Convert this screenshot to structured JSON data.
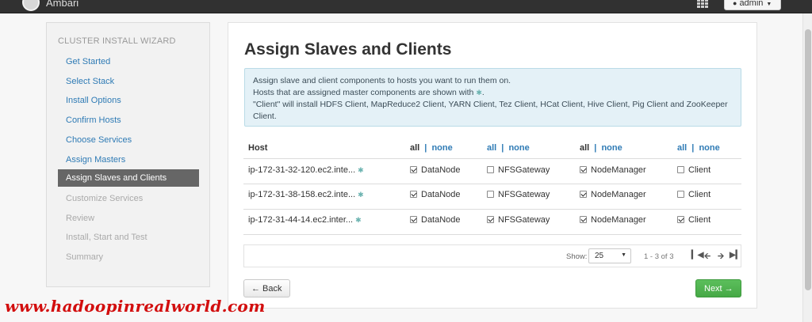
{
  "navbar": {
    "brand": "Ambari",
    "user_label": "admin",
    "icons": {
      "apps": "grid-icon",
      "user": "user-icon",
      "caret": "caret-down-icon"
    }
  },
  "sidebar": {
    "title": "CLUSTER INSTALL WIZARD",
    "steps": [
      {
        "label": "Get Started",
        "state": "done"
      },
      {
        "label": "Select Stack",
        "state": "done"
      },
      {
        "label": "Install Options",
        "state": "done"
      },
      {
        "label": "Confirm Hosts",
        "state": "done"
      },
      {
        "label": "Choose Services",
        "state": "done"
      },
      {
        "label": "Assign Masters",
        "state": "done"
      },
      {
        "label": "Assign Slaves and Clients",
        "state": "current"
      },
      {
        "label": "Customize Services",
        "state": "todo"
      },
      {
        "label": "Review",
        "state": "todo"
      },
      {
        "label": "Install, Start and Test",
        "state": "todo"
      },
      {
        "label": "Summary",
        "state": "todo"
      }
    ]
  },
  "main": {
    "title": "Assign Slaves and Clients",
    "alert": {
      "line1": "Assign slave and client components to hosts you want to run them on.",
      "line2": "Hosts that are assigned master components are shown with",
      "line2_end": ".",
      "line3": "\"Client\" will install HDFS Client, MapReduce2 Client, YARN Client, Tez Client, HCat Client, Hive Client, Pig Client and ZooKeeper Client."
    },
    "table": {
      "host_header": "Host",
      "all": "all",
      "sep": "|",
      "none": "none",
      "rows": [
        {
          "host": "ip-172-31-32-120.ec2.inte...",
          "datanode": true,
          "nfsgateway": false,
          "nodemanager": true,
          "client": false
        },
        {
          "host": "ip-172-31-38-158.ec2.inte...",
          "datanode": true,
          "nfsgateway": false,
          "nodemanager": true,
          "client": false
        },
        {
          "host": "ip-172-31-44-14.ec2.inter...",
          "datanode": true,
          "nfsgateway": true,
          "nodemanager": true,
          "client": true
        }
      ],
      "components": {
        "datanode": "DataNode",
        "nfsgateway": "NFSGateway",
        "nodemanager": "NodeManager",
        "client": "Client"
      }
    },
    "pager": {
      "show_label": "Show:",
      "page_size": "25",
      "range": "1 - 3 of 3"
    },
    "back_label": "← Back",
    "next_label": "Next →"
  },
  "watermark": "www.hadoopinrealworld.com",
  "colors": {
    "navbar": "#313131",
    "link": "#2f7bb5",
    "current_step": "#666666",
    "alert_bg": "#e4f1f7",
    "next_button": "#4cae4c",
    "watermark": "#d20e0e"
  }
}
